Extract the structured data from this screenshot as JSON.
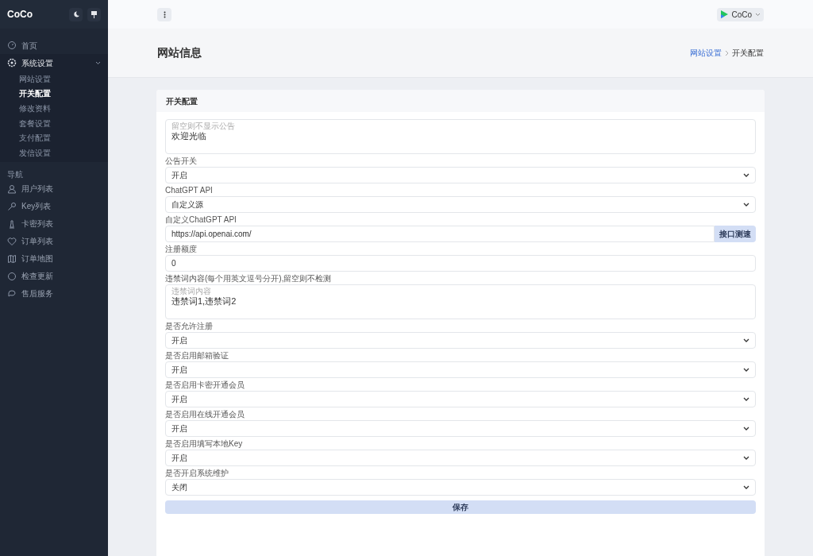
{
  "sidebar": {
    "brand": "CoCo",
    "menu": [
      {
        "label": "首页",
        "expanded": false
      },
      {
        "label": "系统设置",
        "expanded": true,
        "children": [
          {
            "label": "网站设置",
            "selected": false
          },
          {
            "label": "开关配置",
            "selected": true
          },
          {
            "label": "修改资料",
            "selected": false
          },
          {
            "label": "套餐设置",
            "selected": false
          },
          {
            "label": "支付配置",
            "selected": false
          },
          {
            "label": "发信设置",
            "selected": false
          }
        ]
      }
    ],
    "section_title": "导航",
    "nav": [
      {
        "label": "用户列表"
      },
      {
        "label": "Key列表"
      },
      {
        "label": "卡密列表"
      },
      {
        "label": "订单列表"
      },
      {
        "label": "订单地图"
      },
      {
        "label": "检查更新"
      },
      {
        "label": "售后服务"
      }
    ]
  },
  "topbar": {
    "user": "CoCo"
  },
  "header": {
    "title": "网站信息",
    "breadcrumb": [
      {
        "label": "网站设置",
        "link": true
      },
      {
        "label": "开关配置",
        "link": false
      }
    ]
  },
  "card": {
    "title": "开关配置",
    "fields": [
      {
        "kind": "textarea",
        "placeholder": "留空则不显示公告",
        "value": "欢迎光临"
      },
      {
        "kind": "select",
        "label": "公告开关",
        "value": "开启"
      },
      {
        "kind": "select",
        "label": "ChatGPT API",
        "value": "自定义源"
      },
      {
        "kind": "input_button",
        "label": "自定义ChatGPT API",
        "value": "https://api.openai.com/",
        "button": "接口测速"
      },
      {
        "kind": "input",
        "label": "注册额度",
        "value": "0"
      },
      {
        "kind": "textarea",
        "label": "违禁词内容(每个用英文逗号分开),留空则不检测",
        "placeholder": "违禁词内容",
        "value": "违禁词1,违禁词2"
      },
      {
        "kind": "select",
        "label": "是否允许注册",
        "value": "开启"
      },
      {
        "kind": "select",
        "label": "是否启用邮箱验证",
        "value": "开启"
      },
      {
        "kind": "select",
        "label": "是否启用卡密开通会员",
        "value": "开启"
      },
      {
        "kind": "select",
        "label": "是否启用在线开通会员",
        "value": "开启"
      },
      {
        "kind": "select",
        "label": "是否启用填写本地Key",
        "value": "开启"
      },
      {
        "kind": "select",
        "label": "是否开启系统维护",
        "value": "关闭"
      }
    ],
    "save": "保存"
  }
}
